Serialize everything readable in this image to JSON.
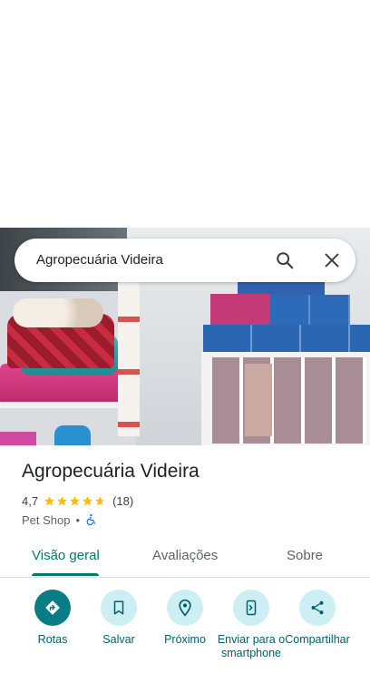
{
  "search": {
    "query": "Agropecuária Videira"
  },
  "place": {
    "name": "Agropecuária Videira",
    "rating": "4,7",
    "rating_stars": 4.7,
    "reviews": "(18)",
    "category": "Pet Shop",
    "separator": "•"
  },
  "tabs": [
    {
      "label": "Visão geral",
      "active": true
    },
    {
      "label": "Avaliações",
      "active": false
    },
    {
      "label": "Sobre",
      "active": false
    }
  ],
  "actions": [
    {
      "label": "Rotas",
      "icon": "directions-icon"
    },
    {
      "label": "Salvar",
      "icon": "bookmark-icon"
    },
    {
      "label": "Próximo",
      "icon": "nearby-icon"
    },
    {
      "label": "Enviar para o smartphone",
      "icon": "send-to-phone-icon"
    },
    {
      "label": "Compartilhar",
      "icon": "share-icon"
    }
  ],
  "colors": {
    "accent": "#00796b",
    "primary_button": "#0a7c86",
    "button_tint": "#cdeff3",
    "star": "#fbbc04"
  }
}
